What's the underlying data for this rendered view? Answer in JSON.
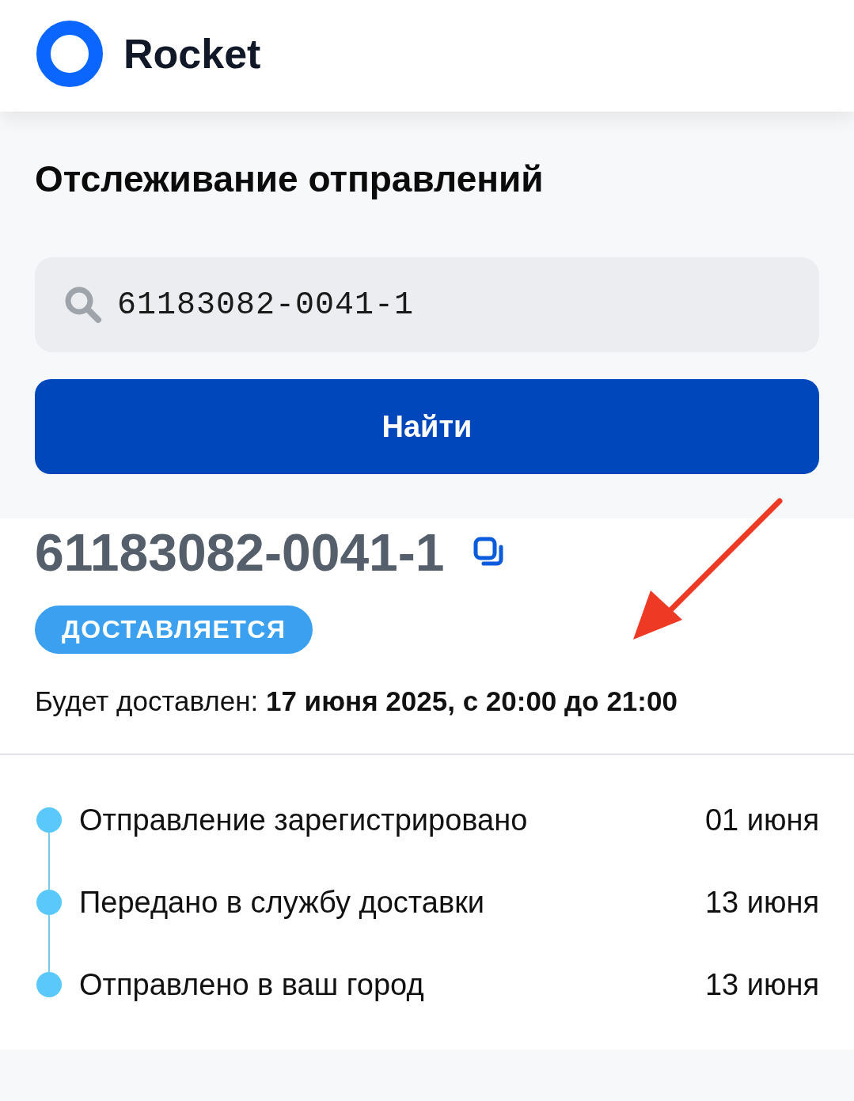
{
  "header": {
    "brand": "Rocket"
  },
  "page_title": "Отслеживание отправлений",
  "search": {
    "value": "61183082-0041-1"
  },
  "find_button": "Найти",
  "shipment": {
    "number": "61183082-0041-1",
    "status": "ДОСТАВЛЯЕТСЯ",
    "delivery": "Будет доставлен: **17 июня 2025, с 20:00 до 21:00**"
  },
  "timeline": [
    {
      "event": "Отправление зарегистрировано",
      "date": "01 июня"
    },
    {
      "event": "Передано в службу доставки",
      "date": "13 июня"
    },
    {
      "event": "Отправлено в ваш город",
      "date": "13 июня"
    }
  ]
}
